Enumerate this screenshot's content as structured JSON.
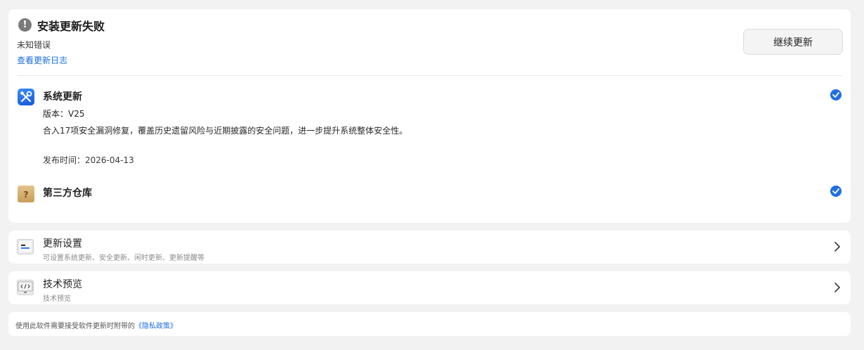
{
  "status": {
    "icon": "warning-icon",
    "title": "安装更新失败",
    "error": "未知错误",
    "log_link": "查看更新日志",
    "continue_button": "继续更新"
  },
  "updates": [
    {
      "icon": "system-update-icon",
      "title": "系统更新",
      "version": "版本：V25",
      "description": "合入17项安全漏洞修复，覆盖历史遗留风险与近期披露的安全问题，进一步提升系统整体安全性。",
      "date": "发布时间：2026-04-13",
      "checked": true
    },
    {
      "icon": "package-unknown-icon",
      "title": "第三方仓库",
      "checked": true
    }
  ],
  "settings": {
    "icon": "update-settings-icon",
    "title": "更新设置",
    "subtitle": "可设置系统更新、安全更新、闲时更新、更新提醒等"
  },
  "preview": {
    "icon": "code-monitor-icon",
    "title": "技术预览",
    "subtitle": "技术预览"
  },
  "footer": {
    "text": "使用此软件需要接受软件更新时附带的",
    "privacy_link": "《隐私政策》"
  },
  "colors": {
    "accent": "#1f6fe0",
    "background": "#f2f2f2",
    "card": "#ffffff"
  }
}
